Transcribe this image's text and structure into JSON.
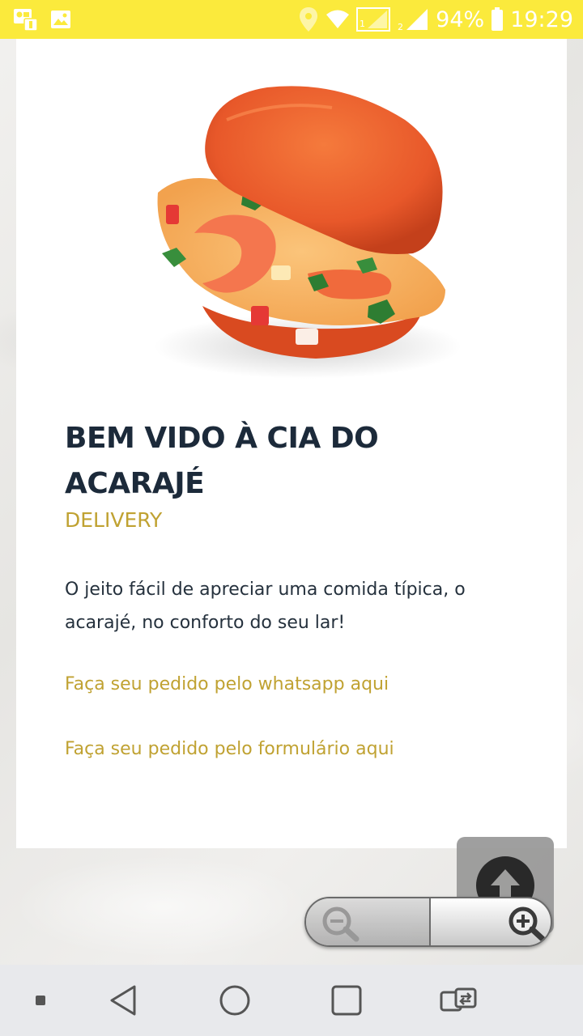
{
  "status_bar": {
    "battery_percent": "94%",
    "time": "19:29",
    "icons": [
      "notification-icon",
      "image-icon",
      "location-icon",
      "wifi-icon",
      "signal-sim1-icon",
      "signal-sim2-icon",
      "battery-icon"
    ]
  },
  "hero": {
    "image_icon": "acaraje-food-image"
  },
  "content": {
    "title": "BEM VIDO À CIA DO ACARAJÉ",
    "subtitle": "DELIVERY",
    "description": "O jeito fácil de apreciar uma comida típica, o acarajé, no conforto do seu lar!",
    "link_whatsapp": "Faça seu pedido pelo whatsapp aqui",
    "link_form": "Faça seu pedido pelo formulário aqui"
  },
  "colors": {
    "status_bar": "#fbea3c",
    "title": "#1c2a3a",
    "accent": "#c0a232",
    "body_text": "#25313d"
  },
  "controls": {
    "scroll_top_icon": "arrow-up-icon",
    "zoom_out_icon": "zoom-out-icon",
    "zoom_in_icon": "zoom-in-icon"
  },
  "navigation": {
    "icons": [
      "square-small-icon",
      "back-icon",
      "home-icon",
      "recents-icon",
      "switch-app-icon"
    ]
  }
}
